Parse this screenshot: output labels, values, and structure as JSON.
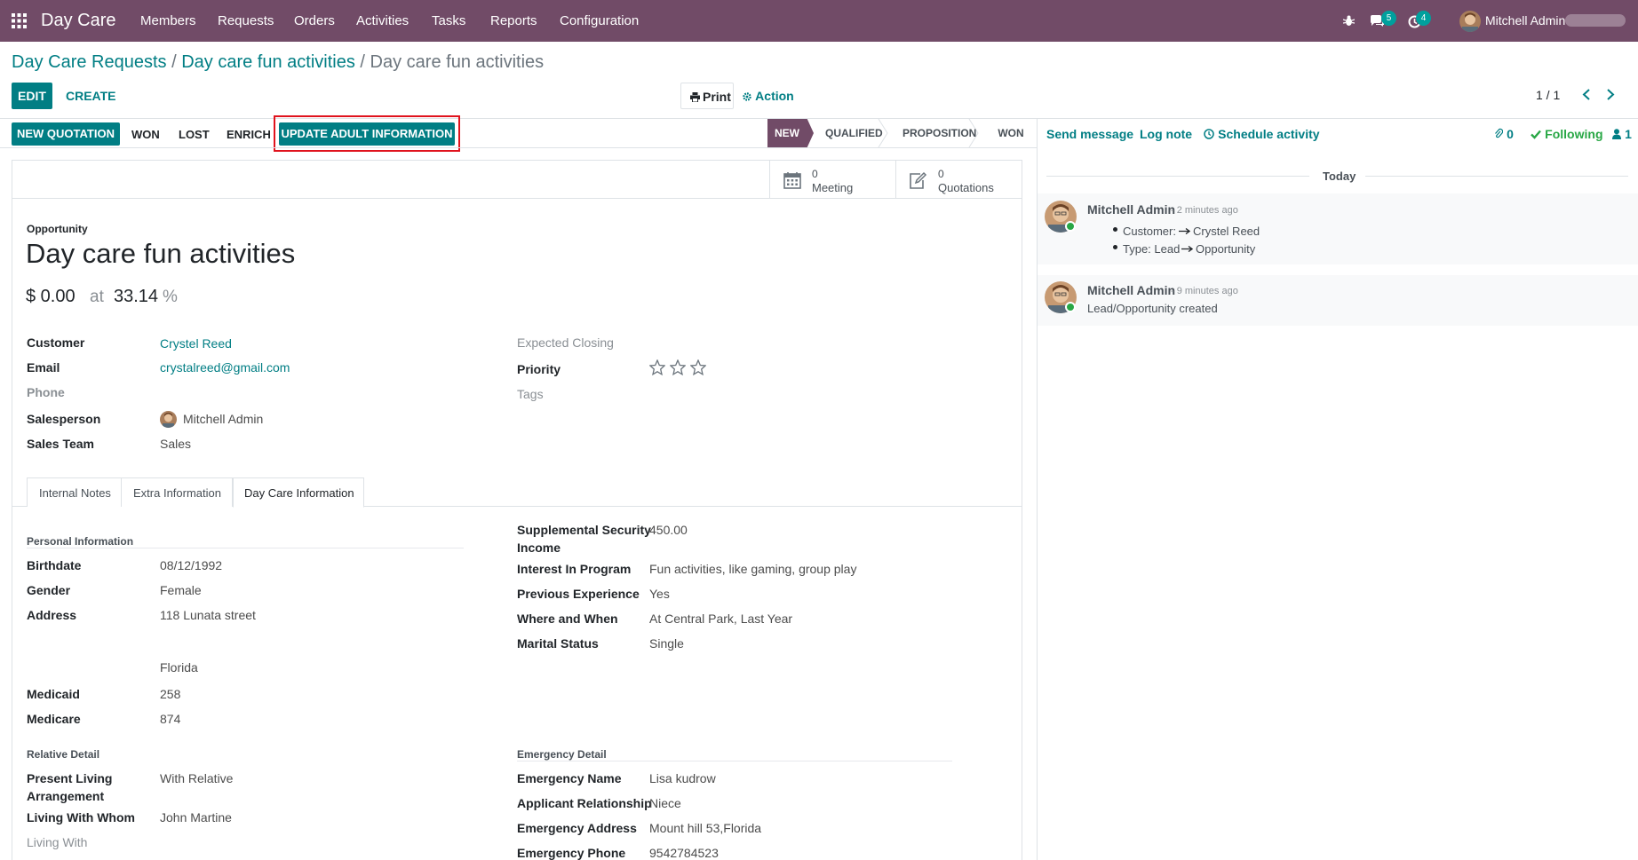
{
  "navbar": {
    "app_name": "Day Care",
    "menus": [
      "Members",
      "Requests",
      "Orders",
      "Activities",
      "Tasks",
      "Reports",
      "Configuration"
    ],
    "messages_count": "5",
    "activities_count": "4",
    "user_name": "Mitchell Admin"
  },
  "breadcrumb": {
    "root": "Day Care Requests",
    "parent": "Day care fun activities",
    "current": "Day care fun activities"
  },
  "toolbar": {
    "edit": "EDIT",
    "create": "CREATE",
    "print": "Print",
    "action": "Action",
    "pager": "1 / 1"
  },
  "statusbar": {
    "buttons": {
      "new_quotation": "NEW QUOTATION",
      "won": "WON",
      "lost": "LOST",
      "enrich": "ENRICH",
      "update_adult": "UPDATE ADULT INFORMATION"
    },
    "stages": [
      "NEW",
      "QUALIFIED",
      "PROPOSITION",
      "WON"
    ],
    "active_stage": "NEW"
  },
  "smart_buttons": {
    "meeting": {
      "count": "0",
      "label": "Meeting"
    },
    "quotations": {
      "count": "0",
      "label": "Quotations"
    }
  },
  "record": {
    "type_label": "Opportunity",
    "name": "Day care fun activities",
    "revenue": "$ 0.00",
    "at": "at",
    "probability": "33.14",
    "percent": "%"
  },
  "fields": {
    "customer": {
      "label": "Customer",
      "value": "Crystel Reed"
    },
    "email": {
      "label": "Email",
      "value": "crystalreed@gmail.com"
    },
    "phone": {
      "label": "Phone"
    },
    "salesperson": {
      "label": "Salesperson",
      "value": "Mitchell Admin"
    },
    "sales_team": {
      "label": "Sales Team",
      "value": "Sales"
    },
    "expected_closing": {
      "label": "Expected Closing"
    },
    "priority": {
      "label": "Priority",
      "stars": 0,
      "max": 3
    },
    "tags": {
      "label": "Tags"
    }
  },
  "tabs": [
    "Internal Notes",
    "Extra Information",
    "Day Care Information"
  ],
  "active_tab": "Day Care Information",
  "personal": {
    "title": "Personal Information",
    "birthdate": {
      "label": "Birthdate",
      "value": "08/12/1992"
    },
    "gender": {
      "label": "Gender",
      "value": "Female"
    },
    "address": {
      "label": "Address",
      "value": "118 Lunata street",
      "state": "Florida"
    },
    "medicaid": {
      "label": "Medicaid",
      "value": "258"
    },
    "medicare": {
      "label": "Medicare",
      "value": "874"
    }
  },
  "program": {
    "ssi_label_1": "Supplemental Security",
    "ssi_label_2": "Income",
    "ssi_value": "450.00",
    "interest": {
      "label": "Interest In Program",
      "value": "Fun activities, like gaming, group play"
    },
    "experience": {
      "label": "Previous Experience",
      "value": "Yes"
    },
    "where_when": {
      "label": "Where and When",
      "value": "At Central Park, Last Year"
    },
    "marital": {
      "label": "Marital Status",
      "value": "Single"
    }
  },
  "relative": {
    "title": "Relative Detail",
    "present_label_1": "Present Living",
    "present_label_2": "Arrangement",
    "present_value": "With Relative",
    "whom": {
      "label": "Living With Whom",
      "value": "John Martine"
    },
    "living_with": {
      "label": "Living With"
    }
  },
  "emergency": {
    "title": "Emergency Detail",
    "name": {
      "label": "Emergency Name",
      "value": "Lisa kudrow"
    },
    "relationship": {
      "label": "Applicant Relationship",
      "value": "Niece"
    },
    "address": {
      "label": "Emergency Address",
      "value": "Mount hill 53,Florida"
    },
    "phone": {
      "label": "Emergency Phone",
      "value": "9542784523"
    }
  },
  "chatter": {
    "send_message": "Send message",
    "log_note": "Log note",
    "schedule_activity": "Schedule activity",
    "attachments": "0",
    "following": "Following",
    "followers": "1",
    "date_separator": "Today",
    "messages": [
      {
        "author": "Mitchell Admin",
        "time": "- 2 minutes ago",
        "line1_label": "Customer:",
        "line1_value": "Crystel Reed",
        "line2_label": "Type: Lead",
        "line2_value": "Opportunity"
      },
      {
        "author": "Mitchell Admin",
        "time": "- 9 minutes ago",
        "body": "Lead/Opportunity created"
      }
    ]
  },
  "colors": {
    "navbar": "#714b67",
    "primary": "#017e84",
    "highlight": "#e0131d",
    "following": "#28a745"
  }
}
